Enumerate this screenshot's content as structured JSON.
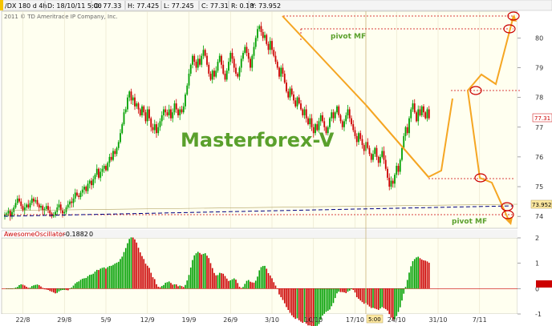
{
  "header": {
    "symbol": "/DX 180 d 4h",
    "date": "D: 18/10/11 5:00",
    "open": "O: 77.33",
    "high": "H: 77.425",
    "low": "L: 77.245",
    "close": "C: 77.31",
    "range": "R: 0.18",
    "y_value": "Y: 73.952"
  },
  "copyright": "2011 © TD Ameritrade IP Company, Inc.",
  "watermark": "Masterforex-V",
  "annotations": {
    "pivot_top": "pivot MF",
    "pivot_bottom": "pivot MF"
  },
  "price_badges": {
    "last": "77.31",
    "cursor": "73.952"
  },
  "cursor_x_badge": "5:00",
  "oscillator": {
    "name": "AwesomeOscillator",
    "value": "-0.1882",
    "level": "0",
    "ylim": [
      -1,
      2
    ],
    "ticks": [
      2,
      1,
      0,
      -1
    ]
  },
  "colors": {
    "background": "#fffff0",
    "up_candle": "#00a000",
    "down_candle": "#cc0000",
    "trend_line": "#f5a623",
    "watermark": "#5aa02c",
    "pivot_dotted": "#cc0000",
    "support_dashed": "#000080",
    "circle": "#cc0000"
  },
  "chart_data": [
    {
      "type": "candlestick",
      "symbol": "/DX",
      "timeframe": "4h",
      "ylim": [
        73.6,
        80.9
      ],
      "y_ticks": [
        80,
        79,
        78,
        77,
        76,
        75,
        74
      ],
      "x_ticks": [
        "22/8",
        "29/8",
        "5/9",
        "12/9",
        "19/9",
        "26/9",
        "3/10",
        "10/10",
        "17/10",
        "24/10",
        "31/10",
        "7/11"
      ],
      "x_tick_index": [
        10,
        33,
        56,
        79,
        102,
        125,
        148,
        171,
        194,
        217,
        240,
        263
      ],
      "closes": [
        74.05,
        74.1,
        74.2,
        74.0,
        74.15,
        74.3,
        74.45,
        74.6,
        74.5,
        74.35,
        74.2,
        74.3,
        74.4,
        74.3,
        74.45,
        74.6,
        74.5,
        74.55,
        74.4,
        74.3,
        74.35,
        74.2,
        74.25,
        74.35,
        74.2,
        74.1,
        74.0,
        74.05,
        74.15,
        74.3,
        74.4,
        74.2,
        74.1,
        74.15,
        74.3,
        74.4,
        74.5,
        74.45,
        74.6,
        74.8,
        74.7,
        74.65,
        74.8,
        74.9,
        75.0,
        74.85,
        75.1,
        75.2,
        75.05,
        75.25,
        75.4,
        75.6,
        75.3,
        75.5,
        75.6,
        75.7,
        75.55,
        75.8,
        76.0,
        75.9,
        76.2,
        76.1,
        76.3,
        76.5,
        76.8,
        77.1,
        77.5,
        77.6,
        78.0,
        78.2,
        77.9,
        78.0,
        77.7,
        77.8,
        77.6,
        77.4,
        77.7,
        77.5,
        77.2,
        77.6,
        77.3,
        77.0,
        76.9,
        77.1,
        76.8,
        77.0,
        77.2,
        77.4,
        77.6,
        77.5,
        77.4,
        77.6,
        77.3,
        77.5,
        77.8,
        77.6,
        77.4,
        77.6,
        77.5,
        77.7,
        78.1,
        78.4,
        78.8,
        79.1,
        79.4,
        79.2,
        79.0,
        79.3,
        79.1,
        79.4,
        79.6,
        79.4,
        79.1,
        78.8,
        78.6,
        78.9,
        78.7,
        78.9,
        79.2,
        79.4,
        79.1,
        78.8,
        78.6,
        78.9,
        79.2,
        79.5,
        79.3,
        79.0,
        78.8,
        78.7,
        79.0,
        79.3,
        79.5,
        79.7,
        79.5,
        79.3,
        79.0,
        79.4,
        79.7,
        80.0,
        80.3,
        80.4,
        80.2,
        80.0,
        80.1,
        79.8,
        79.6,
        79.9,
        79.6,
        79.4,
        79.2,
        79.0,
        78.7,
        79.0,
        78.8,
        78.5,
        78.2,
        78.0,
        78.3,
        78.1,
        77.9,
        77.7,
        78.0,
        77.8,
        77.6,
        77.4,
        77.6,
        77.3,
        77.1,
        77.3,
        77.0,
        76.8,
        77.1,
        76.9,
        77.2,
        77.4,
        77.2,
        77.0,
        76.8,
        77.0,
        77.3,
        77.5,
        77.3,
        77.5,
        77.7,
        77.4,
        77.2,
        77.0,
        77.2,
        77.4,
        77.6,
        77.3,
        77.1,
        76.9,
        76.7,
        76.5,
        76.8,
        76.6,
        76.4,
        76.2,
        76.5,
        76.3,
        76.1,
        75.9,
        76.1,
        76.3,
        76.0,
        75.8,
        76.0,
        76.2,
        75.9,
        75.6,
        75.3,
        75.0,
        75.2,
        75.1,
        75.4,
        75.7,
        75.5,
        75.9,
        76.3,
        76.7,
        77.0,
        76.8,
        77.3,
        77.6,
        77.8,
        77.5,
        77.2,
        77.6,
        77.4,
        77.7,
        77.5,
        77.3,
        77.6,
        77.3
      ]
    },
    {
      "type": "bar",
      "name": "AwesomeOscillator",
      "ylim": [
        -1,
        2
      ],
      "value": -0.1882
    }
  ]
}
